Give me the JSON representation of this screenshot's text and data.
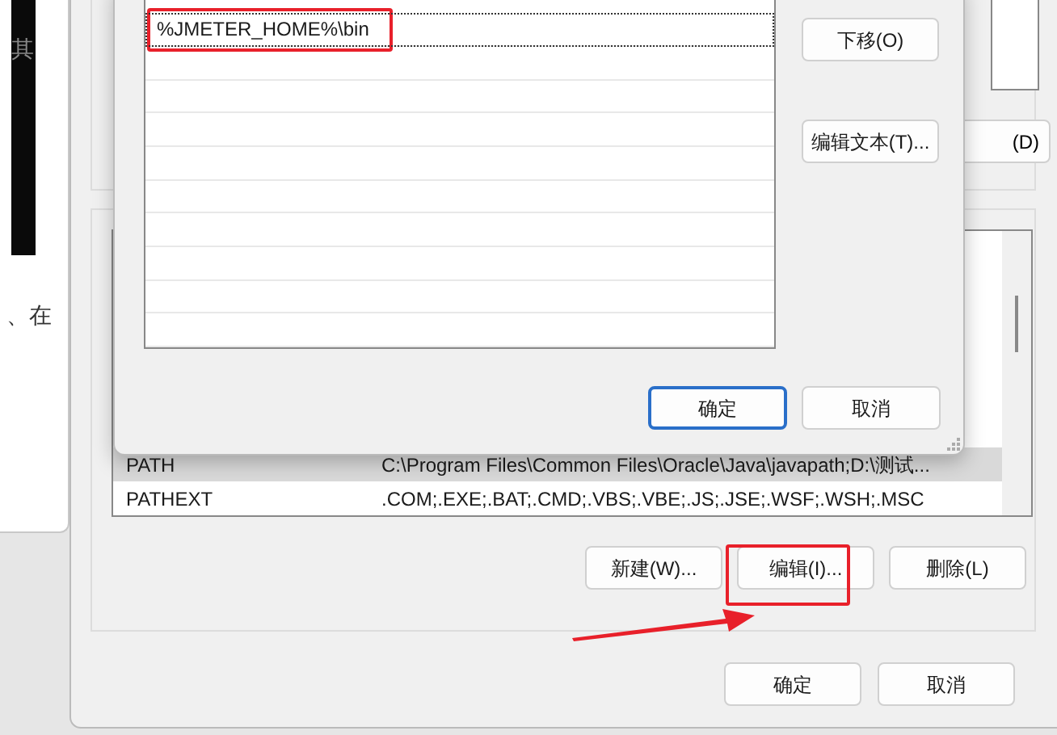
{
  "background_window": {
    "texts": [
      "其",
      "、在"
    ]
  },
  "env_window": {
    "top_button": "(D)",
    "variables": [
      {
        "name": "PATH",
        "value": "C:\\Program Files\\Common Files\\Oracle\\Java\\javapath;D:\\测试...",
        "selected": true
      },
      {
        "name": "PATHEXT",
        "value": ".COM;.EXE;.BAT;.CMD;.VBS;.VBE;.JS;.JSE;.WSF;.WSH;.MSC",
        "selected": false
      }
    ],
    "actions": [
      {
        "label": "新建(W)...",
        "highlighted": false
      },
      {
        "label": "编辑(I)...",
        "highlighted": true
      },
      {
        "label": "删除(L)",
        "highlighted": false
      }
    ],
    "footer_buttons": [
      {
        "label": "确定",
        "default": false
      },
      {
        "label": "取消",
        "default": false
      }
    ]
  },
  "edit_dialog": {
    "entries": [
      {
        "text": "%JMETER_HOME%\\bin",
        "selected": true,
        "highlighted": true
      }
    ],
    "side_buttons": [
      "下移(O)",
      "编辑文本(T)..."
    ],
    "footer_buttons": [
      {
        "label": "确定",
        "default": true
      },
      {
        "label": "取消",
        "default": false
      }
    ]
  }
}
